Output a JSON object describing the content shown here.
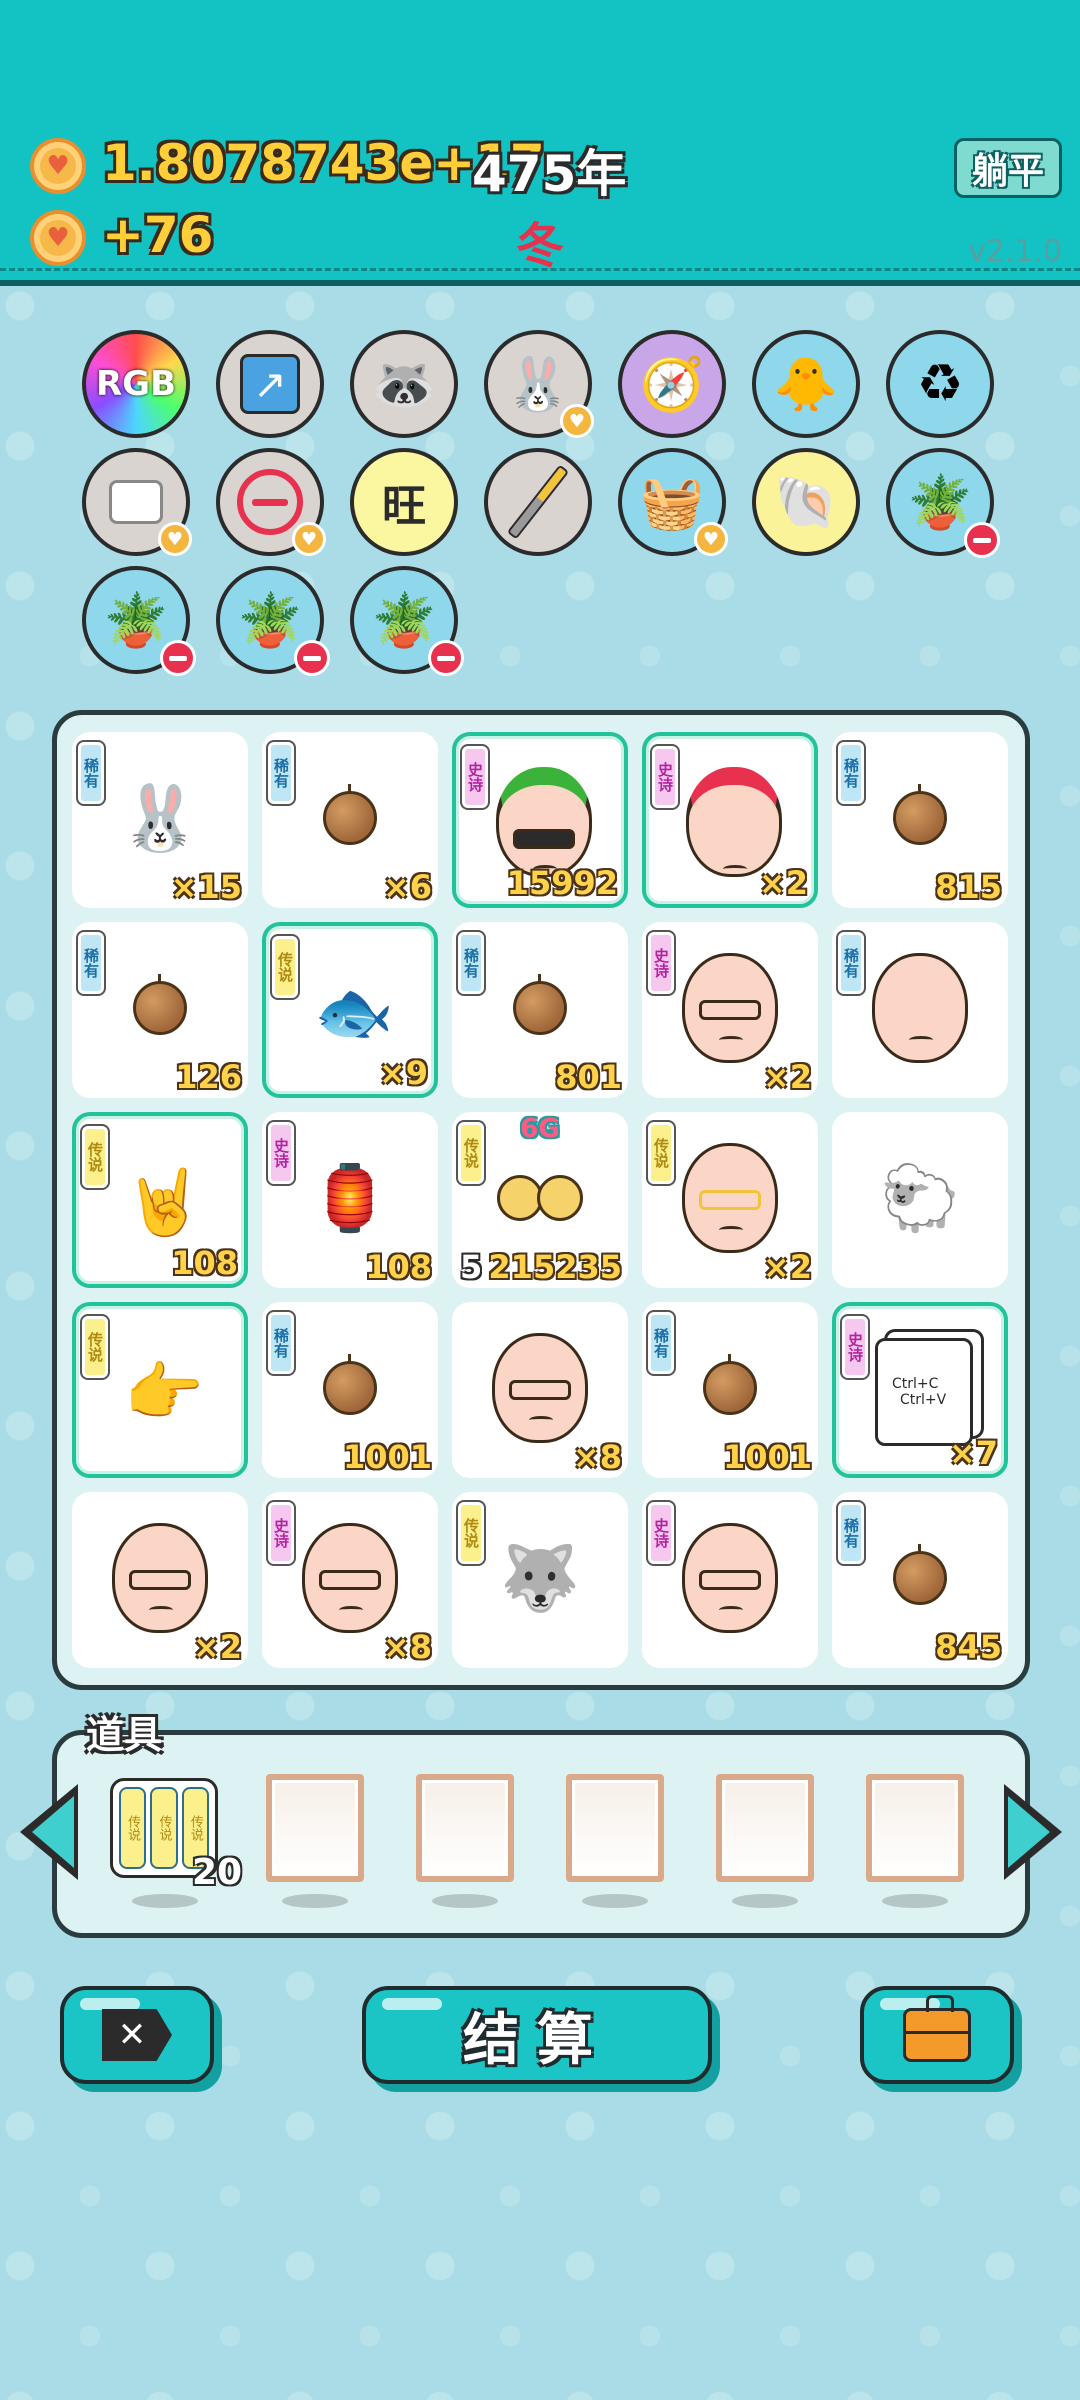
{
  "header": {
    "gold_amount": "1.8078743e+17",
    "year": "475年",
    "income": "+76",
    "season": "冬",
    "flat_button": "躺平",
    "version": "v2.1.0"
  },
  "symbol_tray": {
    "items": [
      {
        "name": "rgb-symbol",
        "label": "RGB"
      },
      {
        "name": "arrow-card-symbol"
      },
      {
        "name": "raccoon-symbol"
      },
      {
        "name": "bunny-symbol"
      },
      {
        "name": "compass-symbol"
      },
      {
        "name": "chick-egg-symbol"
      },
      {
        "name": "recycle-bag-symbol"
      },
      {
        "name": "sugar-cubes-symbol"
      },
      {
        "name": "minus-sign-symbol"
      },
      {
        "name": "wang-symbol",
        "label": "旺"
      },
      {
        "name": "screwdriver-symbol"
      },
      {
        "name": "fruit-basket-symbol"
      },
      {
        "name": "shell-symbol"
      },
      {
        "name": "flower-pot-symbol"
      },
      {
        "name": "flower-pot-symbol"
      },
      {
        "name": "flower-pot-symbol"
      },
      {
        "name": "flower-pot-symbol"
      }
    ]
  },
  "board": {
    "rows": [
      [
        {
          "rarity": "稀有",
          "icon": "bunny-gift",
          "count": "×15"
        },
        {
          "rarity": "稀有",
          "icon": "potato",
          "count": "×6"
        },
        {
          "rarity": "史诗",
          "icon": "sunglasses-old-man",
          "count": "15992",
          "highlight": true
        },
        {
          "rarity": "史诗",
          "icon": "red-cap-kid",
          "count": "×2",
          "highlight": true
        },
        {
          "rarity": "稀有",
          "icon": "potato",
          "count": "815"
        }
      ],
      [
        {
          "rarity": "稀有",
          "icon": "potato",
          "count": "126"
        },
        {
          "rarity": "传说",
          "icon": "koi-fish",
          "count": "×9",
          "highlight": true
        },
        {
          "rarity": "稀有",
          "icon": "potato",
          "count": "801"
        },
        {
          "rarity": "史诗",
          "icon": "old-man-glasses",
          "count": "×2"
        },
        {
          "rarity": "稀有",
          "icon": "bald-man",
          "count": ""
        }
      ],
      [
        {
          "rarity": "传说",
          "icon": "rock-hand",
          "count": "108",
          "highlight": true
        },
        {
          "rarity": "史诗",
          "icon": "bunny-house",
          "count": "108"
        },
        {
          "rarity": "传说",
          "icon": "gold-cherries",
          "count": "215235",
          "left_count": "5",
          "top_label": "6G"
        },
        {
          "rarity": "传说",
          "icon": "gold-teeth-man",
          "count": "×2"
        },
        {
          "rarity": "",
          "icon": "sheep",
          "count": ""
        }
      ],
      [
        {
          "rarity": "传说",
          "icon": "pointing-hand",
          "count": "",
          "highlight": true
        },
        {
          "rarity": "稀有",
          "icon": "potato",
          "count": "1001"
        },
        {
          "rarity": "",
          "icon": "old-man-glasses",
          "count": "×8"
        },
        {
          "rarity": "稀有",
          "icon": "potato",
          "count": "1001"
        },
        {
          "rarity": "史诗",
          "icon": "ctrl-c-ctrl-v",
          "count": "×7",
          "highlight": true,
          "text1": "Ctrl+C",
          "text2": "Ctrl+V"
        }
      ],
      [
        {
          "rarity": "",
          "icon": "old-man-glasses",
          "count": "×2"
        },
        {
          "rarity": "史诗",
          "icon": "old-man-glasses",
          "count": "×8"
        },
        {
          "rarity": "传说",
          "icon": "husky-king",
          "count": ""
        },
        {
          "rarity": "史诗",
          "icon": "old-man-glasses",
          "count": ""
        },
        {
          "rarity": "稀有",
          "icon": "potato",
          "count": "845"
        }
      ]
    ]
  },
  "tools": {
    "title": "道具",
    "item_label": "传说",
    "item_count": "20"
  },
  "buttons": {
    "settle": "结算"
  },
  "colors": {
    "header_bg": "#13c2c2",
    "page_bg": "#a9dce6",
    "gold_text": "#ffcf3a",
    "season_red": "#e8314e",
    "highlight_border": "#22c29a"
  }
}
